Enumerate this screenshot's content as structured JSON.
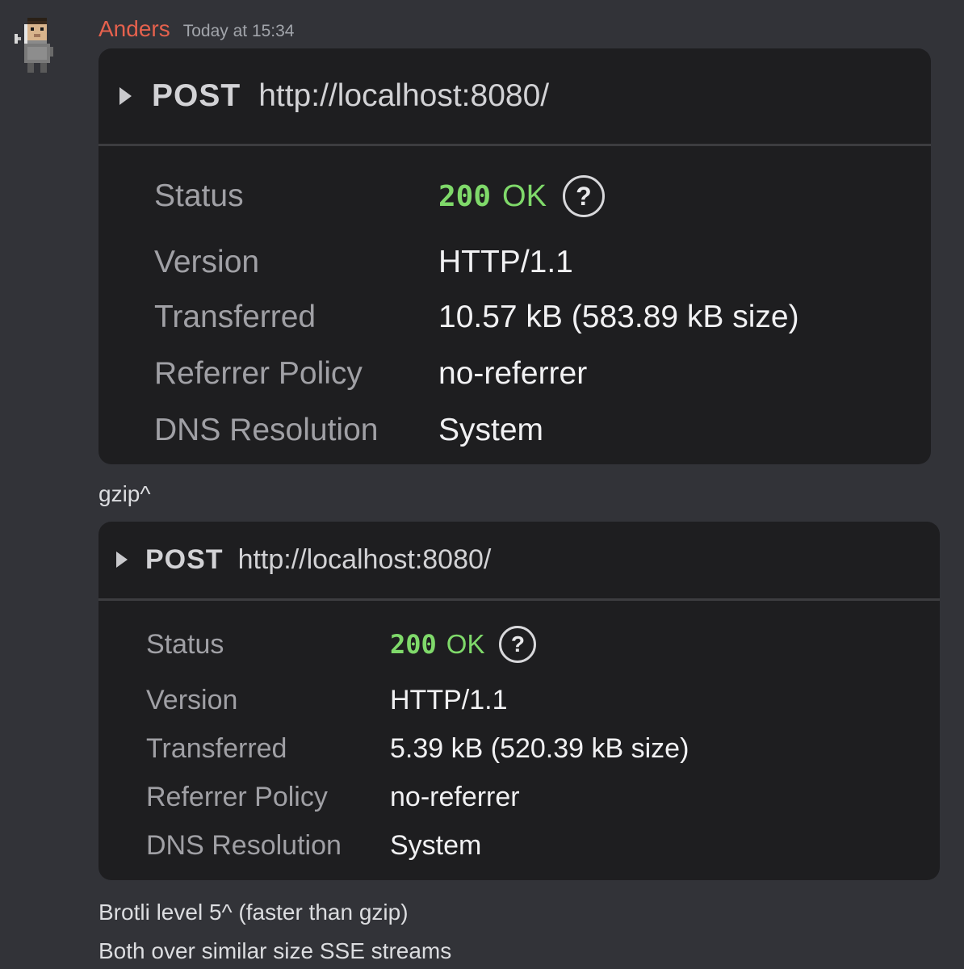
{
  "message": {
    "author": "Anders",
    "timestamp": "Today at 15:34",
    "avatar_icon": "pixel-character-avatar",
    "author_color": "#e5614d"
  },
  "requests": [
    {
      "method": "POST",
      "url": "http://localhost:8080/",
      "rows": {
        "status_label": "Status",
        "status_code": "200",
        "status_text": "OK",
        "help_glyph": "?",
        "version_label": "Version",
        "version_value": "HTTP/1.1",
        "transferred_label": "Transferred",
        "transferred_value": "10.57 kB (583.89 kB size)",
        "referrer_label": "Referrer Policy",
        "referrer_value": "no-referrer",
        "dns_label": "DNS Resolution",
        "dns_value": "System"
      }
    },
    {
      "method": "POST",
      "url": "http://localhost:8080/",
      "rows": {
        "status_label": "Status",
        "status_code": "200",
        "status_text": "OK",
        "help_glyph": "?",
        "version_label": "Version",
        "version_value": "HTTP/1.1",
        "transferred_label": "Transferred",
        "transferred_value": "5.39 kB (520.39 kB size)",
        "referrer_label": "Referrer Policy",
        "referrer_value": "no-referrer",
        "dns_label": "DNS Resolution",
        "dns_value": "System"
      }
    }
  ],
  "captions": [
    "gzip^",
    "Brotli level 5^ (faster than gzip)",
    "Both over similar size SSE streams"
  ],
  "colors": {
    "background": "#323338",
    "panel": "#1e1e20",
    "status_ok": "#7fd96a"
  }
}
